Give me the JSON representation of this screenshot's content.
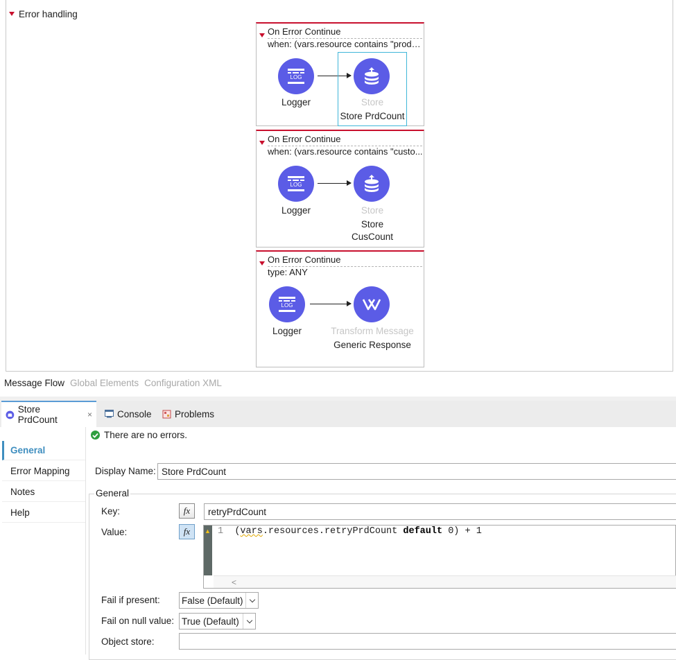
{
  "canvas": {
    "section_title": "Error handling",
    "scopes": [
      {
        "title": "On Error Continue",
        "condition": "when: (vars.resource contains \"produ...",
        "source": {
          "label": "Logger",
          "icon": "logger-icon"
        },
        "target": {
          "type": "Store",
          "label": "Store PrdCount",
          "icon": "object-store-icon",
          "selected": true
        }
      },
      {
        "title": "On Error Continue",
        "condition": "when: (vars.resource contains \"custo...",
        "source": {
          "label": "Logger",
          "icon": "logger-icon"
        },
        "target": {
          "type": "Store",
          "label_line1": "Store",
          "label_line2": "CusCount",
          "icon": "object-store-icon"
        }
      },
      {
        "title": "On Error Continue",
        "condition": "type: ANY",
        "source": {
          "label": "Logger",
          "icon": "logger-icon"
        },
        "target": {
          "type": "Transform Message",
          "label": "Generic Response",
          "icon": "transform-message-icon"
        }
      }
    ],
    "logger_icon_text": "LOG"
  },
  "editor_tabs": {
    "message_flow": "Message Flow",
    "global_elements": "Global Elements",
    "configuration_xml": "Configuration XML"
  },
  "view_tabs": {
    "properties": "Store PrdCount",
    "close": "×",
    "console": "Console",
    "problems": "Problems"
  },
  "sidebar": {
    "items": [
      "General",
      "Error Mapping",
      "Notes",
      "Help"
    ],
    "active": "General"
  },
  "status": {
    "message": "There are no errors."
  },
  "form": {
    "display_name_label": "Display Name:",
    "display_name_value": "Store PrdCount",
    "group_label": "General",
    "key_label": "Key:",
    "key_value": "retryPrdCount",
    "value_label": "Value:",
    "fx": "fx",
    "code": {
      "line_number": "1",
      "open_paren": "(",
      "var_token": "vars",
      "rest": ".resources.retryPrdCount ",
      "keyword": "default",
      "tail": " 0) + 1"
    },
    "scroll_left": "<",
    "fail_if_present_label": "Fail if present:",
    "fail_if_present_value": "False (Default)",
    "fail_on_null_label": "Fail on null value:",
    "fail_on_null_value": "True (Default)",
    "object_store_label": "Object store:",
    "object_store_value": ""
  },
  "colors": {
    "node": "#5b5ce6",
    "scope_accent": "#c8102e",
    "selection": "#3fb6d8",
    "active_sidebar": "#3f8ebf",
    "ok": "#2e9e3f"
  }
}
